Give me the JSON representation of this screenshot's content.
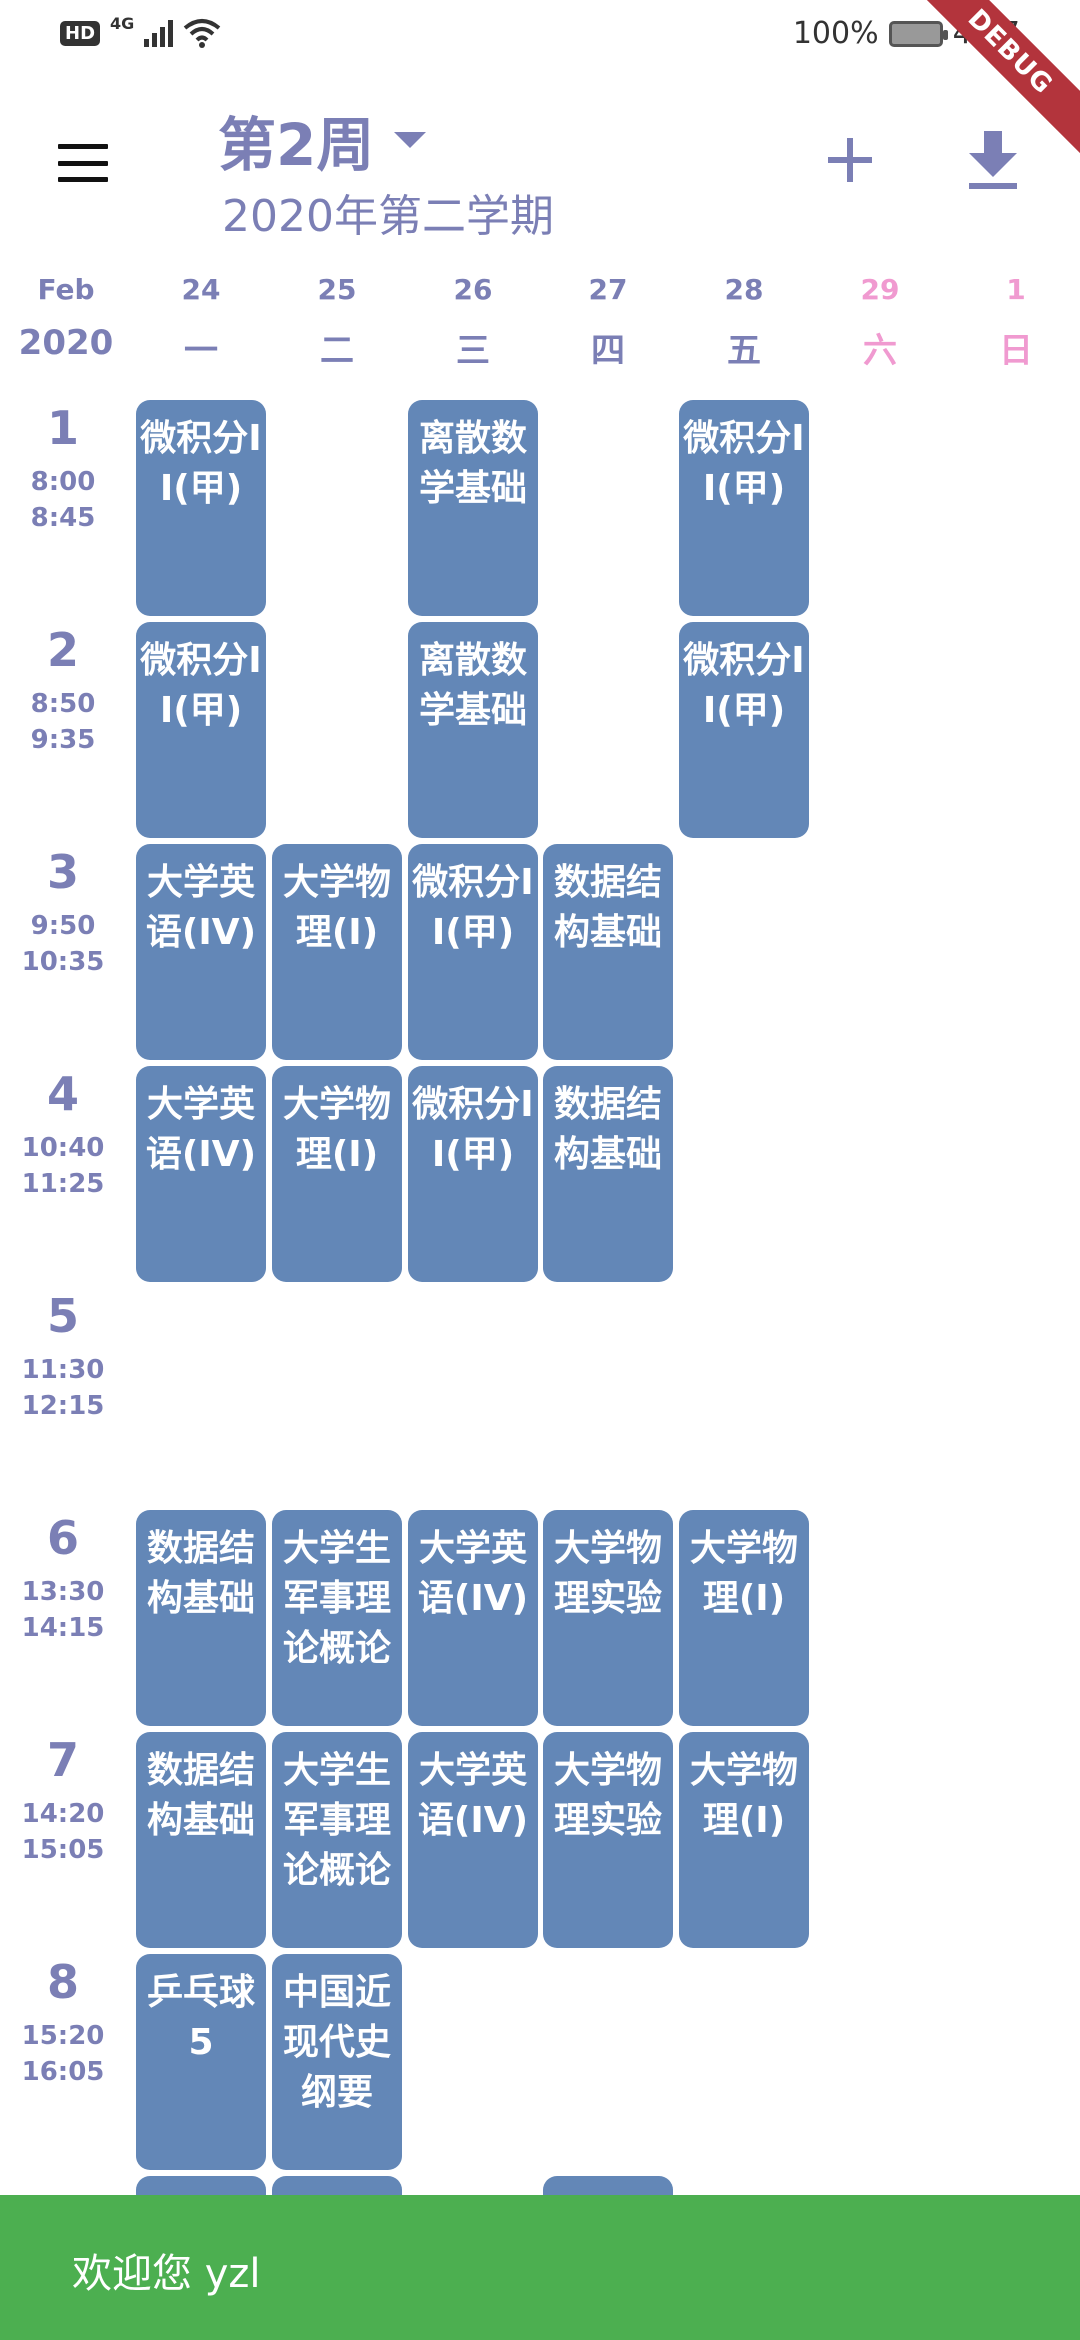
{
  "status_bar": {
    "hd": "HD",
    "network": "4G",
    "battery": "100%",
    "time": "4:47",
    "debug_label": "DEBUG"
  },
  "header": {
    "week": "第2周",
    "semester": "2020年第二学期",
    "icons": [
      "menu-icon",
      "dropdown-caret-icon",
      "add-icon",
      "download-icon"
    ],
    "accent_color": "#7b7fb5"
  },
  "dates": {
    "month": "Feb",
    "year": "2020",
    "days": [
      {
        "num": "24",
        "name": "一"
      },
      {
        "num": "25",
        "name": "二"
      },
      {
        "num": "26",
        "name": "三"
      },
      {
        "num": "27",
        "name": "四"
      },
      {
        "num": "28",
        "name": "五"
      },
      {
        "num": "29",
        "name": "六"
      },
      {
        "num": "1",
        "name": "日"
      }
    ]
  },
  "periods": [
    {
      "num": "1",
      "start": "8:00",
      "end": "8:45"
    },
    {
      "num": "2",
      "start": "8:50",
      "end": "9:35"
    },
    {
      "num": "3",
      "start": "9:50",
      "end": "10:35"
    },
    {
      "num": "4",
      "start": "10:40",
      "end": "11:25"
    },
    {
      "num": "5",
      "start": "11:30",
      "end": "12:15"
    },
    {
      "num": "6",
      "start": "13:30",
      "end": "14:15"
    },
    {
      "num": "7",
      "start": "14:20",
      "end": "15:05"
    },
    {
      "num": "8",
      "start": "15:20",
      "end": "16:05"
    }
  ],
  "courses": [
    {
      "day": 0,
      "period": 0,
      "name": "微积分II(甲)"
    },
    {
      "day": 2,
      "period": 0,
      "name": "离散数学基础"
    },
    {
      "day": 4,
      "period": 0,
      "name": "微积分II(甲)"
    },
    {
      "day": 0,
      "period": 1,
      "name": "微积分II(甲)"
    },
    {
      "day": 2,
      "period": 1,
      "name": "离散数学基础"
    },
    {
      "day": 4,
      "period": 1,
      "name": "微积分II(甲)"
    },
    {
      "day": 0,
      "period": 2,
      "name": "大学英语(IV)"
    },
    {
      "day": 1,
      "period": 2,
      "name": "大学物理(I)"
    },
    {
      "day": 2,
      "period": 2,
      "name": "微积分II(甲)"
    },
    {
      "day": 3,
      "period": 2,
      "name": "数据结构基础"
    },
    {
      "day": 0,
      "period": 3,
      "name": "大学英语(IV)"
    },
    {
      "day": 1,
      "period": 3,
      "name": "大学物理(I)"
    },
    {
      "day": 2,
      "period": 3,
      "name": "微积分II(甲)"
    },
    {
      "day": 3,
      "period": 3,
      "name": "数据结构基础"
    },
    {
      "day": 0,
      "period": 5,
      "name": "数据结构基础"
    },
    {
      "day": 1,
      "period": 5,
      "name": "大学生军事理论概论"
    },
    {
      "day": 2,
      "period": 5,
      "name": "大学英语(IV)"
    },
    {
      "day": 3,
      "period": 5,
      "name": "大学物理实验"
    },
    {
      "day": 4,
      "period": 5,
      "name": "大学物理(I)"
    },
    {
      "day": 0,
      "period": 6,
      "name": "数据结构基础"
    },
    {
      "day": 1,
      "period": 6,
      "name": "大学生军事理论概论"
    },
    {
      "day": 2,
      "period": 6,
      "name": "大学英语(IV)"
    },
    {
      "day": 3,
      "period": 6,
      "name": "大学物理实验"
    },
    {
      "day": 4,
      "period": 6,
      "name": "大学物理(I)"
    },
    {
      "day": 0,
      "period": 7,
      "name": "乒乓球5"
    },
    {
      "day": 1,
      "period": 7,
      "name": "中国近现代史纲要"
    },
    {
      "day": 0,
      "period": 8,
      "name": ""
    },
    {
      "day": 1,
      "period": 8,
      "name": ""
    },
    {
      "day": 3,
      "period": 8,
      "name": ""
    }
  ],
  "course_color": "#6387b7",
  "snackbar": {
    "message": "欢迎您 yzl",
    "color": "#4caf50"
  }
}
